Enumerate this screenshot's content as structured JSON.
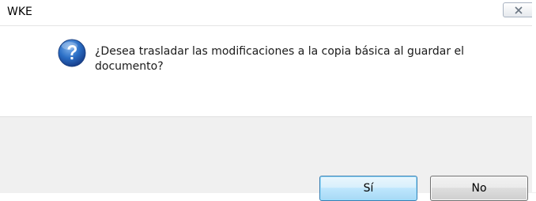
{
  "window": {
    "title": "WKE"
  },
  "icons": {
    "question": "question-icon",
    "close": "close-icon"
  },
  "message": {
    "text": "¿Desea trasladar las modificaciones a la copia básica al guardar el documento?"
  },
  "buttons": {
    "yes_label": "Sí",
    "no_label": "No"
  },
  "colors": {
    "footer_bg": "#f0f0f0",
    "icon_blue": "#1f63b8",
    "default_button_border": "#3c7fb1"
  }
}
